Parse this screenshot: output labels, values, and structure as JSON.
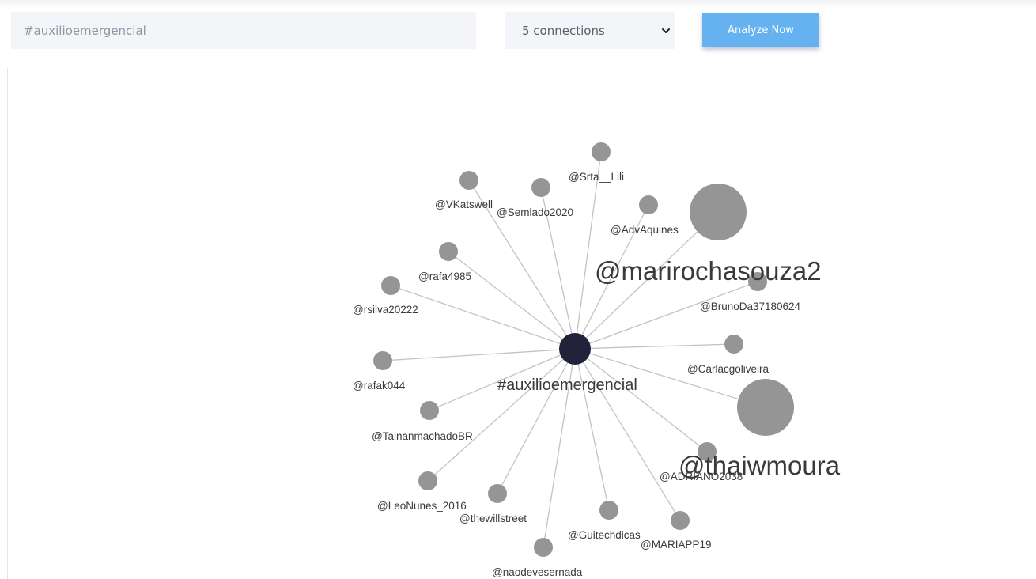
{
  "search": {
    "value": "#auxilioemergencial",
    "placeholder": ""
  },
  "connections": {
    "selected": "5 connections"
  },
  "analyze_button": {
    "label": "Analyze Now"
  },
  "icons": {
    "select_arrow": "chevron-down-icon"
  },
  "colors": {
    "accent": "#66b2f0",
    "center_node": "#22223b",
    "leaf_node": "#959595",
    "edge": "#c3c3c3",
    "label": "#3a3a3a"
  },
  "graph": {
    "center": {
      "label": "#auxilioemergencial"
    },
    "nodes": [
      {
        "id": "srta_lili",
        "label": "@Srta__Lili"
      },
      {
        "id": "vkatswell",
        "label": "@VKatswell"
      },
      {
        "id": "semlado2020",
        "label": "@Semlado2020"
      },
      {
        "id": "advaquines",
        "label": "@AdvAquines"
      },
      {
        "id": "marirochasouza2",
        "label": "@marirochasouza2"
      },
      {
        "id": "rafa4985",
        "label": "@rafa4985"
      },
      {
        "id": "rsilva20222",
        "label": "@rsilva20222"
      },
      {
        "id": "brunoda37180624",
        "label": "@BrunoDa37180624"
      },
      {
        "id": "carlacgoliveira",
        "label": "@Carlacgoliveira"
      },
      {
        "id": "rafak044",
        "label": "@rafak044"
      },
      {
        "id": "thaiwmoura",
        "label": "@thaiwmoura"
      },
      {
        "id": "tainanmachadobr",
        "label": "@TainanmachadoBR"
      },
      {
        "id": "adriano2038",
        "label": "@ADRIANO2038"
      },
      {
        "id": "leonunes_2016",
        "label": "@LeoNunes_2016"
      },
      {
        "id": "thewillstreet",
        "label": "@thewillstreet"
      },
      {
        "id": "guitechdicas",
        "label": "@Guitechdicas"
      },
      {
        "id": "mariapp19",
        "label": "@MARIAPP19"
      },
      {
        "id": "naodevesernada",
        "label": "@naodevesernada"
      }
    ]
  }
}
